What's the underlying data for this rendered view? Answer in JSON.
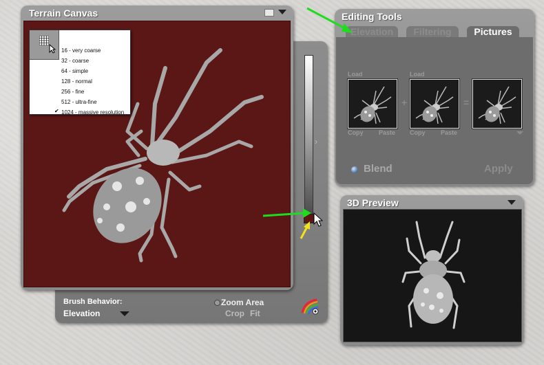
{
  "terrain_canvas": {
    "title": "Terrain Canvas",
    "resolution_options": [
      "16 - very coarse",
      "32 - coarse",
      "64 - simple",
      "128 - normal",
      "256 - fine",
      "512 - ultra-fine",
      "1024 - massive resolution"
    ],
    "selected_resolution": "1024 - massive resolution",
    "brush_behavior_label": "Brush Behavior:",
    "brush_behavior_value": "Elevation",
    "zoom_area_label": "Zoom Area",
    "crop_label": "Crop",
    "fit_label": "Fit",
    "canvas_color": "#5b1716"
  },
  "editing_tools": {
    "title": "Editing Tools",
    "tabs": [
      "Elevation",
      "Filtering",
      "Pictures"
    ],
    "active_tab": "Pictures",
    "load_labels": [
      "Load",
      "Load"
    ],
    "copy_labels": [
      "Copy",
      "Copy"
    ],
    "paste_labels": [
      "Paste",
      "Paste"
    ],
    "operators": [
      "+",
      "="
    ],
    "blend_label": "Blend",
    "apply_label": "Apply"
  },
  "preview_3d": {
    "title": "3D Preview"
  },
  "icons": {
    "resolution_grid": "grid-icon",
    "color_wheel": "color-wheel-icon",
    "pointer": "pointer-icon"
  },
  "annotation_colors": {
    "green_arrow": "#1fdc1f",
    "yellow_arrow": "#f2e21a"
  }
}
